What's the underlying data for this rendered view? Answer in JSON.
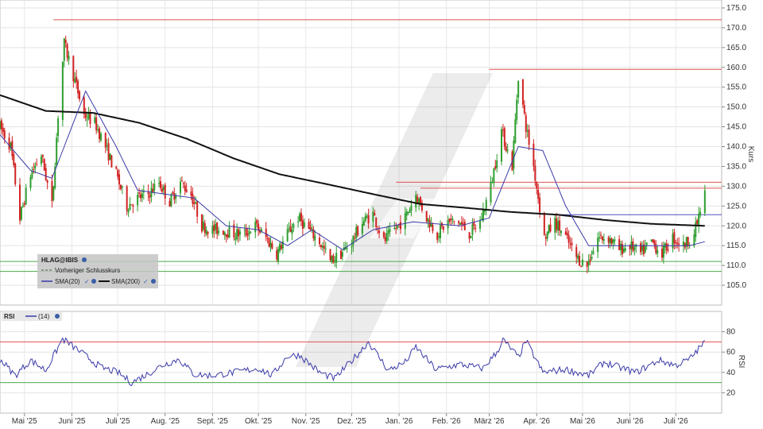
{
  "chart_data": [
    {
      "type": "candlestick",
      "title": "",
      "ylabel": "Kurs",
      "ylim": [
        100,
        177
      ],
      "y_ticks": [
        105,
        110,
        115,
        120,
        125,
        130,
        135,
        140,
        145,
        150,
        155,
        160,
        165,
        170,
        175
      ],
      "y_tick_labels": [
        "105.0",
        "110.0",
        "115.0",
        "120.0",
        "125.0",
        "130.0",
        "135.0",
        "140.0",
        "145.0",
        "150.0",
        "155.0",
        "160.0",
        "165.0",
        "170.0",
        "175.0"
      ],
      "x_axis": {
        "range": [
          "2025-04-15",
          "2026-07-31"
        ],
        "ticks": [
          {
            "label": "Mai '25",
            "date": "2025-05-01"
          },
          {
            "label": "Juni '25",
            "date": "2025-06-01"
          },
          {
            "label": "Juli '25",
            "date": "2025-07-01"
          },
          {
            "label": "Aug. '25",
            "date": "2025-08-01"
          },
          {
            "label": "Sept. '25",
            "date": "2025-09-01"
          },
          {
            "label": "Okt. '25",
            "date": "2025-10-01"
          },
          {
            "label": "Nov. '25",
            "date": "2025-11-01"
          },
          {
            "label": "Dez. '25",
            "date": "2025-12-01"
          },
          {
            "label": "Jan. '26",
            "date": "2026-01-01"
          },
          {
            "label": "Feb. '26",
            "date": "2026-02-01"
          },
          {
            "label": "März '26",
            "date": "2026-03-01"
          },
          {
            "label": "Apr. '26",
            "date": "2026-04-01"
          },
          {
            "label": "Mai '26",
            "date": "2026-05-01"
          },
          {
            "label": "Juni '26",
            "date": "2026-06-01"
          },
          {
            "label": "Juli '26",
            "date": "2026-07-01"
          }
        ]
      },
      "grid": true,
      "legend": {
        "position": "bottom-left",
        "symbol": "HLAG@IBIS",
        "entries": [
          {
            "label": "Vorheriger Schlusskurs",
            "style": "dashed",
            "color": "#555555"
          },
          {
            "label": "SMA(20)",
            "color": "#3a3aa8"
          },
          {
            "label": "SMA(200)",
            "color": "#111111"
          }
        ]
      },
      "colors": {
        "up": "#2e9e2e",
        "down": "#d22222",
        "sma20": "#3a3aa8",
        "sma200": "#111111",
        "resistance": "#e05050",
        "support": "#4aaa4a"
      },
      "horizontal_lines": {
        "resistance": [
          {
            "y": 172,
            "from": "2025-05-20"
          },
          {
            "y": 159.5,
            "from": "2026-03-01"
          },
          {
            "y": 131,
            "from": "2025-12-30"
          },
          {
            "y": 129.5,
            "from": "2026-01-15"
          }
        ],
        "support": [
          {
            "y": 111,
            "from": "2025-04-15"
          },
          {
            "y": 108.5,
            "from": "2025-04-15"
          }
        ],
        "other": [
          {
            "y": 122.8,
            "from": "2026-04-15",
            "color": "#5050c0"
          }
        ]
      },
      "price_anchors": [
        [
          "2025-04-15",
          145
        ],
        [
          "2025-04-22",
          140
        ],
        [
          "2025-04-28",
          122
        ],
        [
          "2025-05-05",
          133
        ],
        [
          "2025-05-12",
          138
        ],
        [
          "2025-05-19",
          125
        ],
        [
          "2025-05-23",
          148
        ],
        [
          "2025-05-27",
          166
        ],
        [
          "2025-06-02",
          158
        ],
        [
          "2025-06-09",
          148
        ],
        [
          "2025-06-16",
          146
        ],
        [
          "2025-06-23",
          140
        ],
        [
          "2025-06-30",
          133
        ],
        [
          "2025-07-07",
          125
        ],
        [
          "2025-07-14",
          127
        ],
        [
          "2025-07-21",
          128
        ],
        [
          "2025-07-28",
          131
        ],
        [
          "2025-08-04",
          126
        ],
        [
          "2025-08-11",
          131
        ],
        [
          "2025-08-18",
          128
        ],
        [
          "2025-08-25",
          120
        ],
        [
          "2025-09-01",
          119
        ],
        [
          "2025-09-08",
          119
        ],
        [
          "2025-09-15",
          118
        ],
        [
          "2025-09-22",
          118
        ],
        [
          "2025-09-29",
          120
        ],
        [
          "2025-10-06",
          117
        ],
        [
          "2025-10-13",
          113
        ],
        [
          "2025-10-20",
          118
        ],
        [
          "2025-10-27",
          122
        ],
        [
          "2025-11-03",
          119
        ],
        [
          "2025-11-10",
          116
        ],
        [
          "2025-11-17",
          111
        ],
        [
          "2025-11-24",
          113
        ],
        [
          "2025-12-01",
          116
        ],
        [
          "2025-12-08",
          121
        ],
        [
          "2025-12-15",
          123
        ],
        [
          "2025-12-22",
          116
        ],
        [
          "2026-01-05",
          122
        ],
        [
          "2026-01-12",
          128
        ],
        [
          "2026-01-19",
          122
        ],
        [
          "2026-01-26",
          118
        ],
        [
          "2026-02-02",
          121
        ],
        [
          "2026-02-09",
          121
        ],
        [
          "2026-02-16",
          118
        ],
        [
          "2026-02-23",
          121
        ],
        [
          "2026-03-02",
          130
        ],
        [
          "2026-03-09",
          144
        ],
        [
          "2026-03-16",
          135
        ],
        [
          "2026-03-20",
          158
        ],
        [
          "2026-03-25",
          145
        ],
        [
          "2026-03-30",
          135
        ],
        [
          "2026-04-06",
          117
        ],
        [
          "2026-04-13",
          121
        ],
        [
          "2026-04-20",
          117
        ],
        [
          "2026-04-27",
          112
        ],
        [
          "2026-05-04",
          110
        ],
        [
          "2026-05-11",
          117
        ],
        [
          "2026-05-18",
          117
        ],
        [
          "2026-05-25",
          114
        ],
        [
          "2026-06-01",
          115
        ],
        [
          "2026-06-08",
          113
        ],
        [
          "2026-06-15",
          116
        ],
        [
          "2026-06-22",
          113
        ],
        [
          "2026-06-29",
          117
        ],
        [
          "2026-07-06",
          115
        ],
        [
          "2026-07-13",
          118
        ],
        [
          "2026-07-20",
          128
        ]
      ],
      "sma200_anchors": [
        [
          "2025-04-15",
          153
        ],
        [
          "2025-05-15",
          149
        ],
        [
          "2025-06-15",
          148.5
        ],
        [
          "2025-07-15",
          146
        ],
        [
          "2025-08-15",
          142
        ],
        [
          "2025-09-15",
          137
        ],
        [
          "2025-10-15",
          133
        ],
        [
          "2025-11-15",
          130.5
        ],
        [
          "2025-12-15",
          128
        ],
        [
          "2026-01-15",
          125.5
        ],
        [
          "2026-02-15",
          124.5
        ],
        [
          "2026-03-15",
          123.5
        ],
        [
          "2026-04-15",
          122.8
        ],
        [
          "2026-05-15",
          121.5
        ],
        [
          "2026-06-15",
          120.5
        ],
        [
          "2026-07-20",
          120
        ]
      ],
      "sma20_anchors": [
        [
          "2025-04-15",
          143
        ],
        [
          "2025-05-05",
          134
        ],
        [
          "2025-05-19",
          132
        ],
        [
          "2025-06-01",
          145
        ],
        [
          "2025-06-10",
          154
        ],
        [
          "2025-06-30",
          140
        ],
        [
          "2025-07-14",
          129
        ],
        [
          "2025-08-01",
          128
        ],
        [
          "2025-08-20",
          127
        ],
        [
          "2025-09-10",
          120
        ],
        [
          "2025-10-01",
          119
        ],
        [
          "2025-10-20",
          115
        ],
        [
          "2025-11-05",
          119
        ],
        [
          "2025-11-25",
          114
        ],
        [
          "2025-12-15",
          119
        ],
        [
          "2026-01-10",
          121
        ],
        [
          "2026-02-10",
          120
        ],
        [
          "2026-03-01",
          122
        ],
        [
          "2026-03-20",
          140
        ],
        [
          "2026-04-05",
          139
        ],
        [
          "2026-04-20",
          125
        ],
        [
          "2026-05-05",
          115
        ],
        [
          "2026-06-01",
          115
        ],
        [
          "2026-07-10",
          115
        ],
        [
          "2026-07-20",
          116
        ]
      ]
    },
    {
      "type": "line",
      "title": "",
      "indicator": "RSI",
      "ylabel": "RSI",
      "period_label": "(14)",
      "ylim": [
        0,
        100
      ],
      "y_ticks": [
        20,
        40,
        60,
        80
      ],
      "thresholds": {
        "overbought": 70,
        "oversold": 30
      },
      "colors": {
        "line": "#3a3aa8",
        "overbought": "#e05050",
        "oversold": "#4aaa4a"
      },
      "rsi_anchors": [
        [
          "2025-04-15",
          53
        ],
        [
          "2025-04-25",
          37
        ],
        [
          "2025-05-05",
          52
        ],
        [
          "2025-05-15",
          42
        ],
        [
          "2025-05-26",
          73
        ],
        [
          "2025-06-05",
          62
        ],
        [
          "2025-06-20",
          45
        ],
        [
          "2025-07-01",
          40
        ],
        [
          "2025-07-10",
          30
        ],
        [
          "2025-07-20",
          38
        ],
        [
          "2025-07-30",
          47
        ],
        [
          "2025-08-10",
          53
        ],
        [
          "2025-08-20",
          38
        ],
        [
          "2025-09-01",
          37
        ],
        [
          "2025-09-15",
          40
        ],
        [
          "2025-10-01",
          44
        ],
        [
          "2025-10-10",
          37
        ],
        [
          "2025-10-20",
          56
        ],
        [
          "2025-10-28",
          57
        ],
        [
          "2025-11-10",
          40
        ],
        [
          "2025-11-20",
          34
        ],
        [
          "2025-12-05",
          58
        ],
        [
          "2025-12-12",
          70
        ],
        [
          "2025-12-25",
          42
        ],
        [
          "2026-01-05",
          50
        ],
        [
          "2026-01-12",
          65
        ],
        [
          "2026-01-25",
          43
        ],
        [
          "2026-02-10",
          48
        ],
        [
          "2026-02-25",
          44
        ],
        [
          "2026-03-06",
          60
        ],
        [
          "2026-03-10",
          72
        ],
        [
          "2026-03-20",
          55
        ],
        [
          "2026-03-25",
          71
        ],
        [
          "2026-04-05",
          40
        ],
        [
          "2026-04-20",
          43
        ],
        [
          "2026-05-05",
          37
        ],
        [
          "2026-05-15",
          50
        ],
        [
          "2026-05-25",
          45
        ],
        [
          "2026-06-05",
          40
        ],
        [
          "2026-06-20",
          52
        ],
        [
          "2026-07-01",
          47
        ],
        [
          "2026-07-10",
          53
        ],
        [
          "2026-07-20",
          70
        ]
      ]
    }
  ],
  "legend_panel": {
    "symbol": "HLAG@IBIS",
    "prev_close_label": "Vorheriger Schlusskurs",
    "sma20_label": "SMA(20)",
    "sma200_label": "SMA(200)"
  },
  "rsi_panel": {
    "name": "RSI",
    "period": "(14)",
    "axis_label": "RSI"
  },
  "price_panel": {
    "axis_label": "Kurs"
  }
}
